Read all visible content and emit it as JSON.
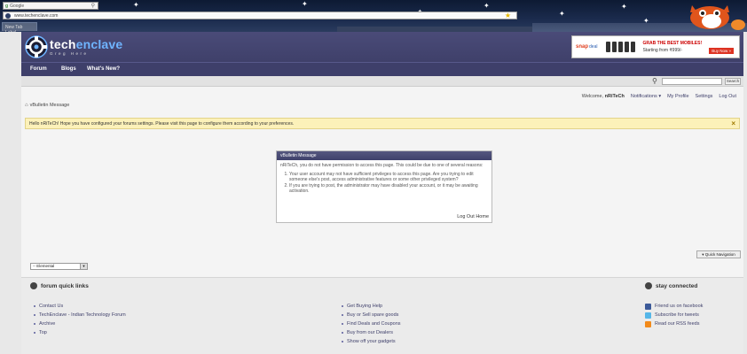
{
  "browser": {
    "search_label": "Google",
    "url": "www.techenclave.com",
    "tab_title": "New Tab Label"
  },
  "site": {
    "logo": {
      "name_part1": "tech",
      "name_part2": "enclave",
      "tagline": "Greg    Here"
    },
    "ad": {
      "brand": "snap",
      "brand2": "deal",
      "headline": "GRAB THE BEST MOBILES!",
      "price": "Starting from ₹999/-",
      "buy": "Buy Now »"
    },
    "nav": [
      "Forum",
      "Blogs",
      "What's New?"
    ],
    "search_button": "Search",
    "user_nav": {
      "welcome": "Welcome,",
      "username": "nRiTeCh",
      "notifications": "Notifications ▾",
      "profile": "My Profile",
      "settings": "Settings",
      "logout": "Log Out"
    },
    "breadcrumb": "vBulletin Message",
    "notice": "Hello nRiTeCh! Hope you have configured your forums settings. Please visit this page to configure them according to your preferences.",
    "message": {
      "title": "vBulletin Message",
      "intro": "nRiTeCh, you do not have permission to access this page. This could be due to one of several reasons:",
      "reasons": [
        "Your user account may not have sufficient privileges to access this page. Are you trying to edit someone else's post, access administrative features or some other privileged system?",
        "If you are trying to post, the administrator may have disabled your account, or it may be awaiting activation."
      ],
      "logout": "Log Out",
      "home": "Home"
    },
    "style_select": "-- Elemental",
    "quick_nav": "▾ Quick Navigation",
    "footer": {
      "quick_links_title": "forum quick links",
      "quick_links": [
        "Contact Us",
        "TechEnclave - Indian Technology Forum",
        "Archive",
        "Top"
      ],
      "more_links": [
        "Get Buying Help",
        "Buy or Sell spare goods",
        "Find Deals and Coupons",
        "Buy from our Dealers",
        "Show off your gadgets"
      ],
      "connect_title": "stay connected",
      "connect_links": [
        "Friend us on facebook",
        "Subscribe for tweets",
        "Read our RSS feeds"
      ]
    }
  },
  "colors": {
    "header": "#4a4b78",
    "nav": "#3e3f6a",
    "notice": "#fcf1b9",
    "facebook": "#3b5998",
    "twitter": "#55b6e8",
    "rss": "#f28a1a"
  }
}
